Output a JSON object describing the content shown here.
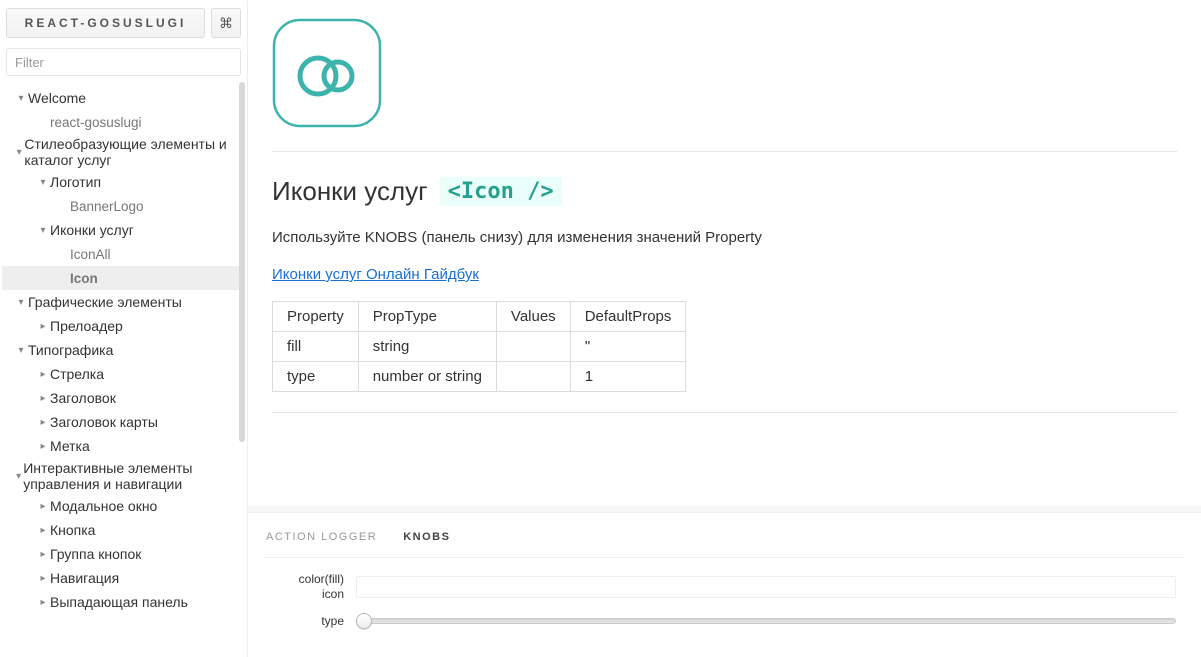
{
  "header": {
    "brand": "REACT-GOSUSLUGI",
    "shortcut_glyph": "⌘",
    "filter_placeholder": "Filter"
  },
  "sidebar": {
    "nodes": [
      {
        "label": "Welcome",
        "level": 0,
        "arrow": "down"
      },
      {
        "label": "react-gosuslugi",
        "level": 1,
        "arrow": "none",
        "child": true
      },
      {
        "label": "Стилеобразующие элементы и каталог услуг",
        "level": 0,
        "arrow": "down"
      },
      {
        "label": "Логотип",
        "level": 1,
        "arrow": "down"
      },
      {
        "label": "BannerLogo",
        "level": 2,
        "arrow": "none",
        "child": true
      },
      {
        "label": "Иконки услуг",
        "level": 1,
        "arrow": "down"
      },
      {
        "label": "IconAll",
        "level": 2,
        "arrow": "none",
        "child": true
      },
      {
        "label": "Icon",
        "level": 2,
        "arrow": "none",
        "child": true,
        "selected": true
      },
      {
        "label": "Графические элементы",
        "level": 0,
        "arrow": "down"
      },
      {
        "label": "Прелоадер",
        "level": 1,
        "arrow": "right"
      },
      {
        "label": "Типографика",
        "level": 0,
        "arrow": "down"
      },
      {
        "label": "Стрелка",
        "level": 1,
        "arrow": "right"
      },
      {
        "label": "Заголовок",
        "level": 1,
        "arrow": "right"
      },
      {
        "label": "Заголовок карты",
        "level": 1,
        "arrow": "right"
      },
      {
        "label": "Метка",
        "level": 1,
        "arrow": "right"
      },
      {
        "label": "Интерактивные элементы управления и навигации",
        "level": 0,
        "arrow": "down"
      },
      {
        "label": "Модальное окно",
        "level": 1,
        "arrow": "right"
      },
      {
        "label": "Кнопка",
        "level": 1,
        "arrow": "right"
      },
      {
        "label": "Группа кнопок",
        "level": 1,
        "arrow": "right"
      },
      {
        "label": "Навигация",
        "level": 1,
        "arrow": "right"
      },
      {
        "label": "Выпадающая панель",
        "level": 1,
        "arrow": "right"
      }
    ]
  },
  "preview": {
    "title_text": "Иконки услуг",
    "title_code": "<Icon />",
    "description": "Используйте KNOBS (панель снизу) для изменения значений Property",
    "doc_link_text": "Иконки услуг Онлайн Гайдбук",
    "table": {
      "headers": [
        "Property",
        "PropType",
        "Values",
        "DefaultProps"
      ],
      "rows": [
        {
          "c0": "fill",
          "c1": "string",
          "c2": "",
          "c3": "''"
        },
        {
          "c0": "type",
          "c1": "number or string",
          "c2": "",
          "c3": "1"
        }
      ]
    },
    "logo_color": "#3cb4ac"
  },
  "panel": {
    "tabs": [
      {
        "label": "ACTION LOGGER",
        "active": false
      },
      {
        "label": "KNOBS",
        "active": true
      }
    ],
    "knobs": {
      "color_label_line1": "color(fill)",
      "color_label_line2": "icon",
      "color_value": "",
      "type_label": "type",
      "type_value": 1
    }
  }
}
